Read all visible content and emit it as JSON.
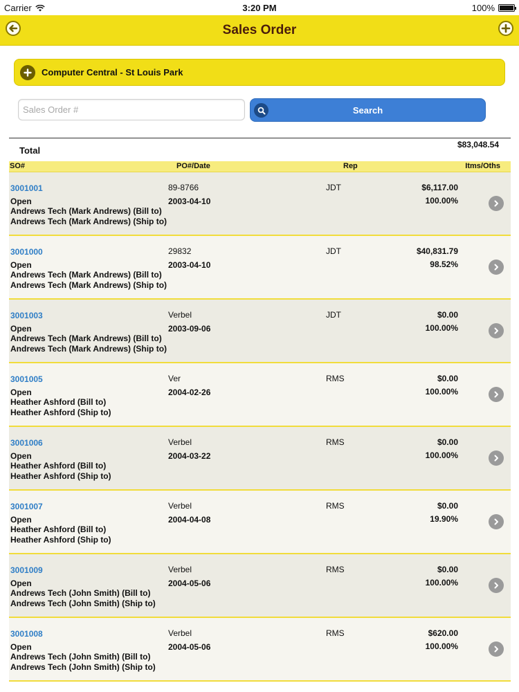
{
  "status_bar": {
    "carrier": "Carrier",
    "time": "3:20 PM",
    "battery": "100%",
    "battery_level": 1.0
  },
  "nav": {
    "title": "Sales Order",
    "back_icon": "back-arrow-icon",
    "add_icon": "plus-icon"
  },
  "location": {
    "name": "Computer Central - St Louis Park"
  },
  "search": {
    "placeholder": "Sales Order #",
    "value": "",
    "button_label": "Search"
  },
  "total": {
    "label": "Total",
    "value": "$83,048.54"
  },
  "columns": {
    "so": "SO#",
    "po_date": "PO#/Date",
    "rep": "Rep",
    "items": "Itms/Oths"
  },
  "orders": [
    {
      "so": "3001001",
      "status": "Open",
      "bill_to": "Andrews Tech (Mark Andrews) (Bill to)",
      "ship_to": "Andrews Tech (Mark Andrews) (Ship to)",
      "po": "89-8766",
      "date": "2003-04-10",
      "rep": "JDT",
      "amount": "$6,117.00",
      "pct": "100.00%"
    },
    {
      "so": "3001000",
      "status": "Open",
      "bill_to": "Andrews Tech (Mark Andrews) (Bill to)",
      "ship_to": "Andrews Tech (Mark Andrews) (Ship to)",
      "po": "29832",
      "date": "2003-04-10",
      "rep": "JDT",
      "amount": "$40,831.79",
      "pct": "98.52%"
    },
    {
      "so": "3001003",
      "status": "Open",
      "bill_to": "Andrews Tech (Mark Andrews) (Bill to)",
      "ship_to": "Andrews Tech (Mark Andrews) (Ship to)",
      "po": "Verbel",
      "date": "2003-09-06",
      "rep": "JDT",
      "amount": "$0.00",
      "pct": "100.00%"
    },
    {
      "so": "3001005",
      "status": "Open",
      "bill_to": "Heather Ashford (Bill to)",
      "ship_to": "Heather Ashford (Ship to)",
      "po": "Ver",
      "date": "2004-02-26",
      "rep": "RMS",
      "amount": "$0.00",
      "pct": "100.00%"
    },
    {
      "so": "3001006",
      "status": "Open",
      "bill_to": "Heather Ashford (Bill to)",
      "ship_to": "Heather Ashford (Ship to)",
      "po": "Verbel",
      "date": "2004-03-22",
      "rep": "RMS",
      "amount": "$0.00",
      "pct": "100.00%"
    },
    {
      "so": "3001007",
      "status": "Open",
      "bill_to": "Heather Ashford (Bill to)",
      "ship_to": "Heather Ashford (Ship to)",
      "po": "Verbel",
      "date": "2004-04-08",
      "rep": "RMS",
      "amount": "$0.00",
      "pct": "19.90%"
    },
    {
      "so": "3001009",
      "status": "Open",
      "bill_to": "Andrews Tech (John Smith) (Bill to)",
      "ship_to": "Andrews Tech (John Smith) (Ship to)",
      "po": "Verbel",
      "date": "2004-05-06",
      "rep": "RMS",
      "amount": "$0.00",
      "pct": "100.00%"
    },
    {
      "so": "3001008",
      "status": "Open",
      "bill_to": "Andrews Tech (John Smith) (Bill to)",
      "ship_to": "Andrews Tech (John Smith) (Ship to)",
      "po": "Verbel",
      "date": "2004-05-06",
      "rep": "RMS",
      "amount": "$620.00",
      "pct": "100.00%"
    }
  ],
  "colors": {
    "nav_yellow": "#f1de17",
    "header_yellow": "#f7ec7e",
    "link_blue": "#2f7ec6",
    "search_blue": "#3d7fd6",
    "row_odd": "#ecebe3",
    "row_even": "#f6f5ef"
  }
}
